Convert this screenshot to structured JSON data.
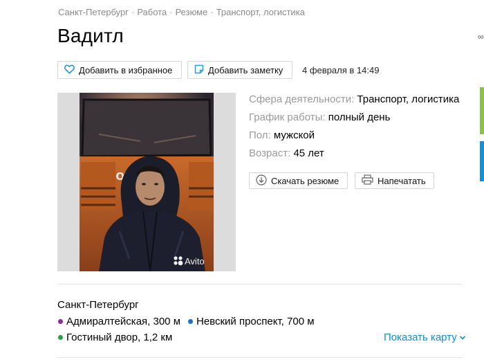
{
  "breadcrumb": [
    "Санкт-Петербург",
    "Работа",
    "Резюме",
    "Транспорт, логистика"
  ],
  "title": "Вадитл",
  "actions": {
    "favorite_label": "Добавить в избранное",
    "note_label": "Добавить заметку",
    "date": "4 февраля в 14:49"
  },
  "photo": {
    "watermark": "Avito",
    "truck_brand": "VOLVO"
  },
  "params": [
    {
      "key": "Сфера деятельности:",
      "value": "Транспорт, логистика"
    },
    {
      "key": "График работы:",
      "value": "полный день"
    },
    {
      "key": "Пол:",
      "value": "мужской"
    },
    {
      "key": "Возраст:",
      "value": "45 лет"
    }
  ],
  "resume_actions": {
    "download_label": "Скачать резюме",
    "print_label": "Напечатать"
  },
  "location": {
    "city": "Санкт-Петербург",
    "metro": [
      {
        "name": "Адмиралтейская, 300 м",
        "color": "#8b2d9e"
      },
      {
        "name": "Невский проспект, 700 м",
        "color": "#1a73c9"
      },
      {
        "name": "Гостиный двор, 1,2 км",
        "color": "#2e9e44"
      }
    ],
    "show_map_label": "Показать карту"
  },
  "colors": {
    "accent": "#0a8fd5",
    "heart": "#1a8fd0",
    "note": "#1aa0e0"
  },
  "icons": [
    "heart-icon",
    "note-icon",
    "download-icon",
    "print-icon",
    "chevron-down-icon"
  ]
}
